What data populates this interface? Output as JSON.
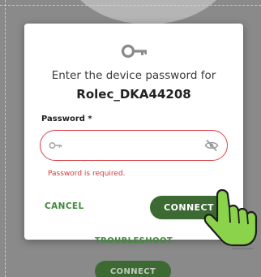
{
  "dialog": {
    "icon": "key-icon",
    "prompt": "Enter the device password for",
    "device_name": "Rolec_DKA44208",
    "password_label": "Password *",
    "password_value": "",
    "field_icon": "key-icon",
    "visibility_icon": "eye-slash-icon",
    "error_text": "Password is required.",
    "cancel_label": "CANCEL",
    "connect_label": "CONNECT",
    "troubleshoot_label": "TROUBLESHOOT"
  },
  "background": {
    "connect_label": "CONNECT"
  },
  "pointer": {
    "icon": "hand-pointer-icon"
  },
  "colors": {
    "accent_green": "#3d6a33",
    "link_green": "#3f8a3a",
    "error_red": "#d33b3f",
    "pointer_green": "#8bd34a"
  }
}
